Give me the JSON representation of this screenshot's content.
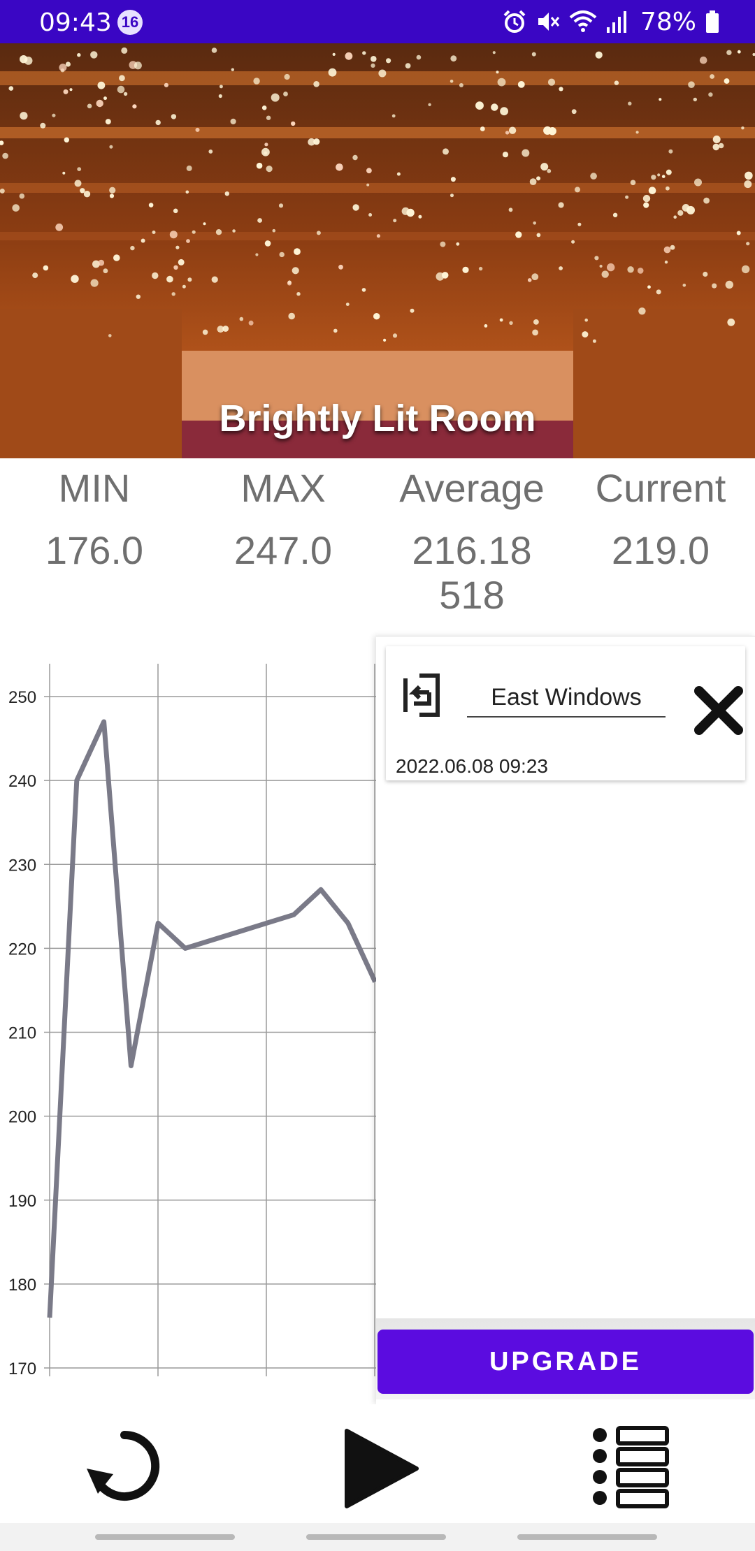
{
  "status_bar": {
    "time": "09:43",
    "notification_count": "16",
    "battery": "78%",
    "icons": [
      "alarm-icon",
      "mute-icon",
      "wifi-icon",
      "signal-icon",
      "battery-icon"
    ],
    "background": "#3a06c4"
  },
  "hero": {
    "caption": "Brightly Lit Room"
  },
  "stats": {
    "min_label": "MIN",
    "max_label": "MAX",
    "avg_label": "Average",
    "current_label": "Current",
    "min_value": "176.0",
    "max_value": "247.0",
    "avg_value": "216.18518",
    "current_value": "219.0"
  },
  "chart_data": {
    "type": "line",
    "title": "",
    "xlabel": "",
    "ylabel": "",
    "ylim": [
      170,
      250
    ],
    "yticks": [
      "250",
      "240",
      "230",
      "220",
      "210",
      "200",
      "190",
      "180",
      "170"
    ],
    "grid": true,
    "series": [
      {
        "values": [
          176,
          240,
          247,
          206,
          223,
          220,
          221,
          222,
          223,
          224,
          227,
          223,
          216
        ]
      }
    ],
    "line_color": "#7a7a88"
  },
  "panel": {
    "card": {
      "name": "East Windows",
      "date": "2022.06.08 09:23"
    },
    "upgrade_label": "UPGRADE",
    "accent": "#5b0ce0"
  },
  "toolbar": {
    "icons": [
      "reset-icon",
      "play-icon",
      "list-icon"
    ]
  }
}
